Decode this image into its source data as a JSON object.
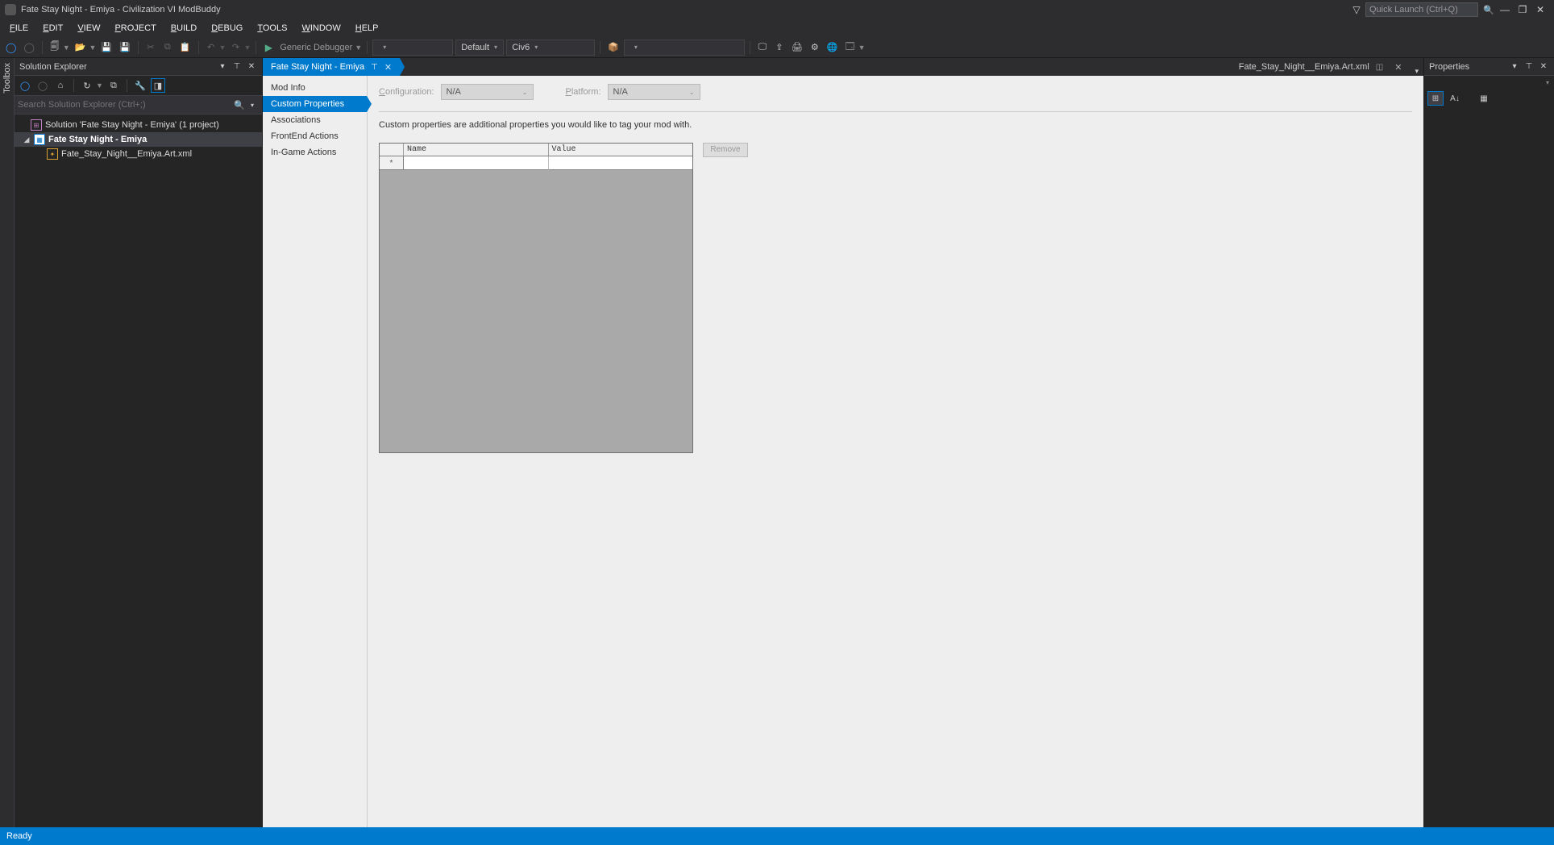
{
  "title": "Fate Stay Night - Emiya - Civilization VI ModBuddy",
  "quicklaunch_placeholder": "Quick Launch (Ctrl+Q)",
  "menu": [
    "FILE",
    "EDIT",
    "VIEW",
    "PROJECT",
    "BUILD",
    "DEBUG",
    "TOOLS",
    "WINDOW",
    "HELP"
  ],
  "toolbar": {
    "debugger_label": "Generic Debugger",
    "config": "Default",
    "platform": "Civ6"
  },
  "solution_explorer": {
    "title": "Solution Explorer",
    "search_placeholder": "Search Solution Explorer (Ctrl+;)",
    "solution": "Solution 'Fate Stay Night - Emiya' (1 project)",
    "project": "Fate Stay Night - Emiya",
    "file": "Fate_Stay_Night__Emiya.Art.xml"
  },
  "tabs": {
    "active": "Fate Stay Night - Emiya",
    "inactive": "Fate_Stay_Night__Emiya.Art.xml"
  },
  "sidenav": {
    "items": [
      "Mod Info",
      "Custom Properties",
      "Associations",
      "FrontEnd Actions",
      "In-Game Actions"
    ],
    "active_index": 1
  },
  "editor": {
    "config_label": "Configuration:",
    "config_value": "N/A",
    "platform_label": "Platform:",
    "platform_value": "N/A",
    "description": "Custom properties are additional properties you would like to tag your mod with.",
    "col_name": "Name",
    "col_value": "Value",
    "row_marker": "*",
    "remove_btn": "Remove"
  },
  "properties": {
    "title": "Properties"
  },
  "toolbox_label": "Toolbox",
  "status": "Ready"
}
